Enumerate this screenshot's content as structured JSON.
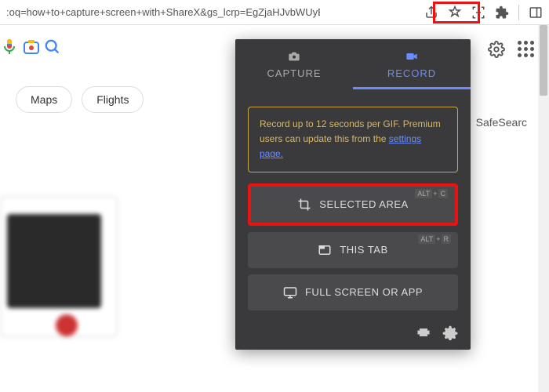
{
  "browser": {
    "url_fragment": ":oq=how+to+capture+screen+with+ShareX&gs_lcrp=EgZjaHJvbWUyBggAEE..."
  },
  "chips": {
    "maps": "Maps",
    "flights": "Flights"
  },
  "right_link": "SafeSearc",
  "popup": {
    "tabs": {
      "capture": "CAPTURE",
      "record": "RECORD"
    },
    "notice": {
      "text_1": "Record up to 12 seconds per GIF. Premium users can update this from the ",
      "link": "settings page."
    },
    "buttons": {
      "selected": "SELECTED AREA",
      "selected_shortcut_1": "ALT",
      "selected_shortcut_plus": "+",
      "selected_shortcut_2": "C",
      "thistab": "THIS TAB",
      "thistab_shortcut_1": "ALT",
      "thistab_shortcut_2": "R",
      "fullscreen": "FULL SCREEN OR APP"
    }
  }
}
